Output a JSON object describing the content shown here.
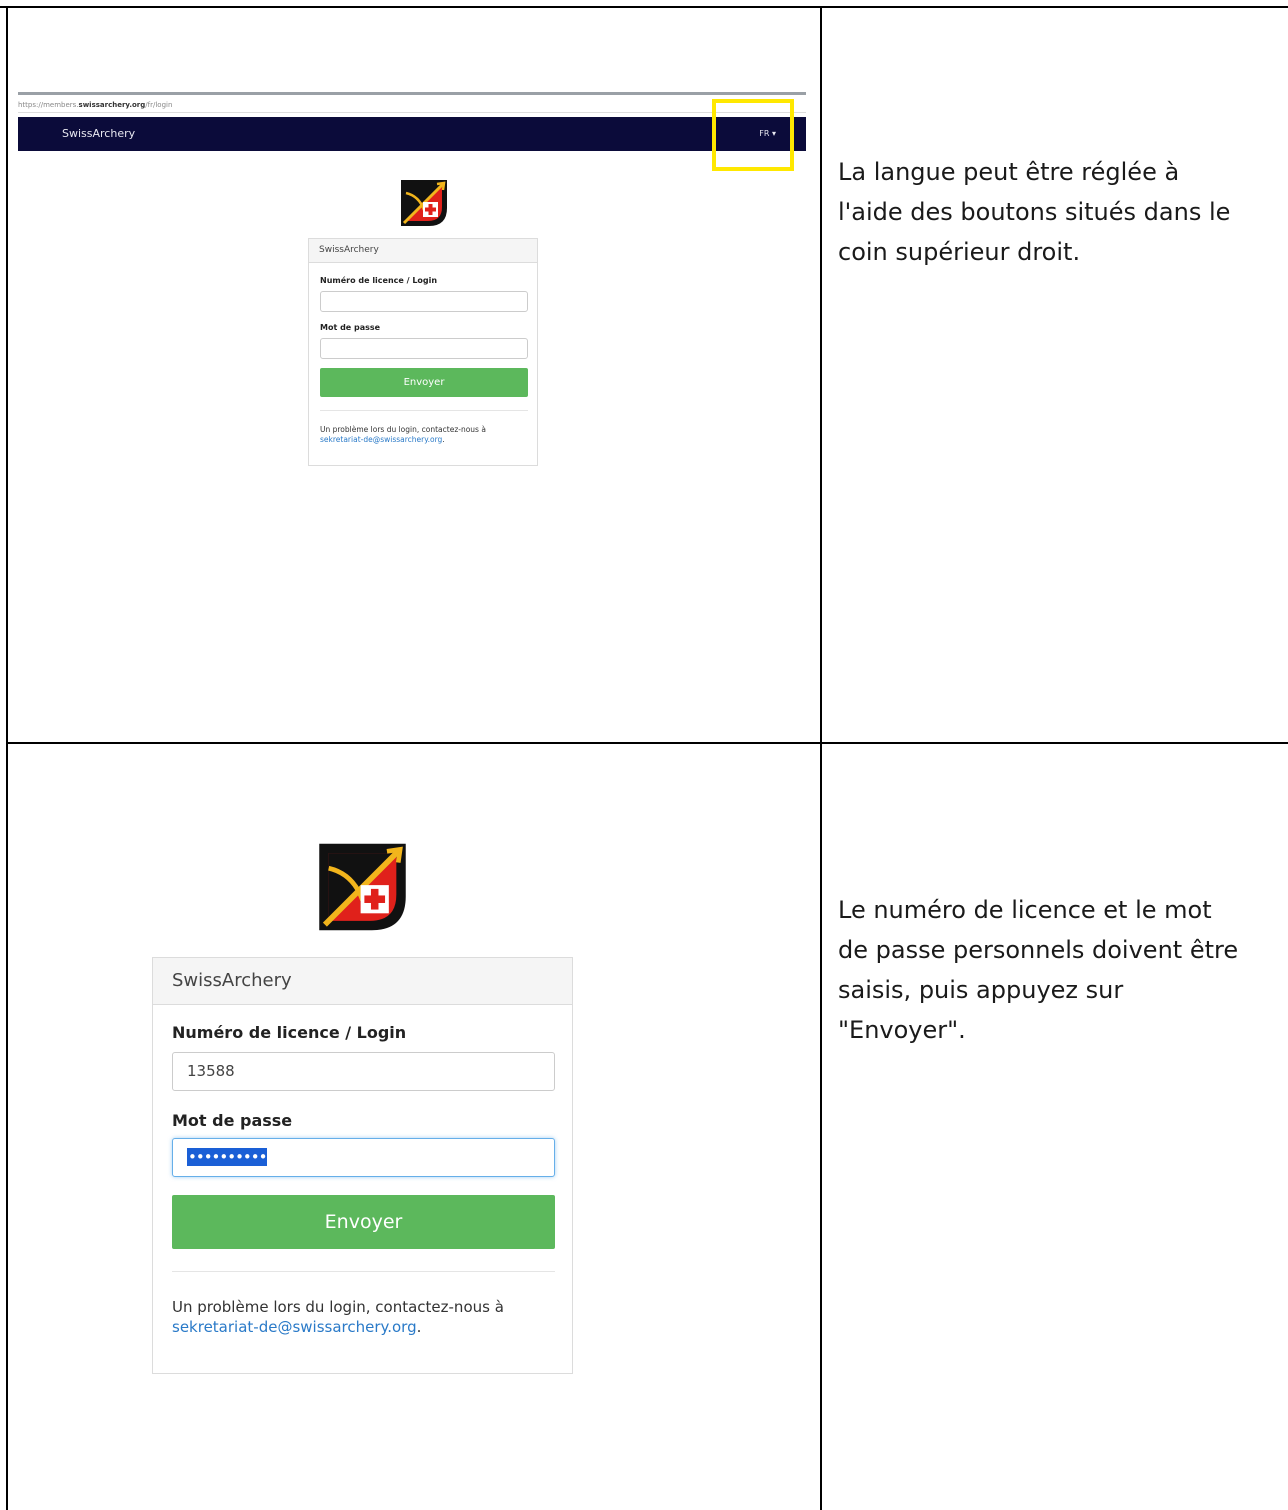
{
  "step1": {
    "url_prefix": "https://members.",
    "url_domain": "swissarchery.org",
    "url_path": "/fr/login",
    "brand": "SwissArchery",
    "lang_label": "FR",
    "lang_caret": "▾",
    "form": {
      "header": "SwissArchery",
      "license_label": "Numéro de licence / Login",
      "license_value": "",
      "password_label": "Mot de passe",
      "password_value": "",
      "submit_label": "Envoyer",
      "help_text": "Un problème lors du login, contactez-nous à",
      "help_email": "sekretariat-de@swissarchery.org",
      "help_end": "."
    },
    "caption_lines": [
      "La langue peut être réglée à",
      "l'aide des boutons situés dans le",
      "coin supérieur droit."
    ]
  },
  "step2": {
    "form": {
      "header": "SwissArchery",
      "license_label": "Numéro de licence / Login",
      "license_value": "13588",
      "password_label": "Mot de passe",
      "password_value": "••••••••••",
      "submit_label": "Envoyer",
      "help_text": "Un problème lors du login, contactez-nous à",
      "help_email": "sekretariat-de@swissarchery.org",
      "help_end": "."
    },
    "caption_lines": [
      "Le numéro de licence et le mot",
      "de passe personnels doivent être",
      "saisis, puis appuyez sur",
      "\"Envoyer\"."
    ]
  },
  "colors": {
    "navbar": "#0b0b3a",
    "highlight": "#ffe800",
    "submit": "#5cb85c",
    "link": "#2a7ac8",
    "logo_red": "#e0211b",
    "logo_gold": "#f2b51c",
    "logo_black": "#111111"
  }
}
